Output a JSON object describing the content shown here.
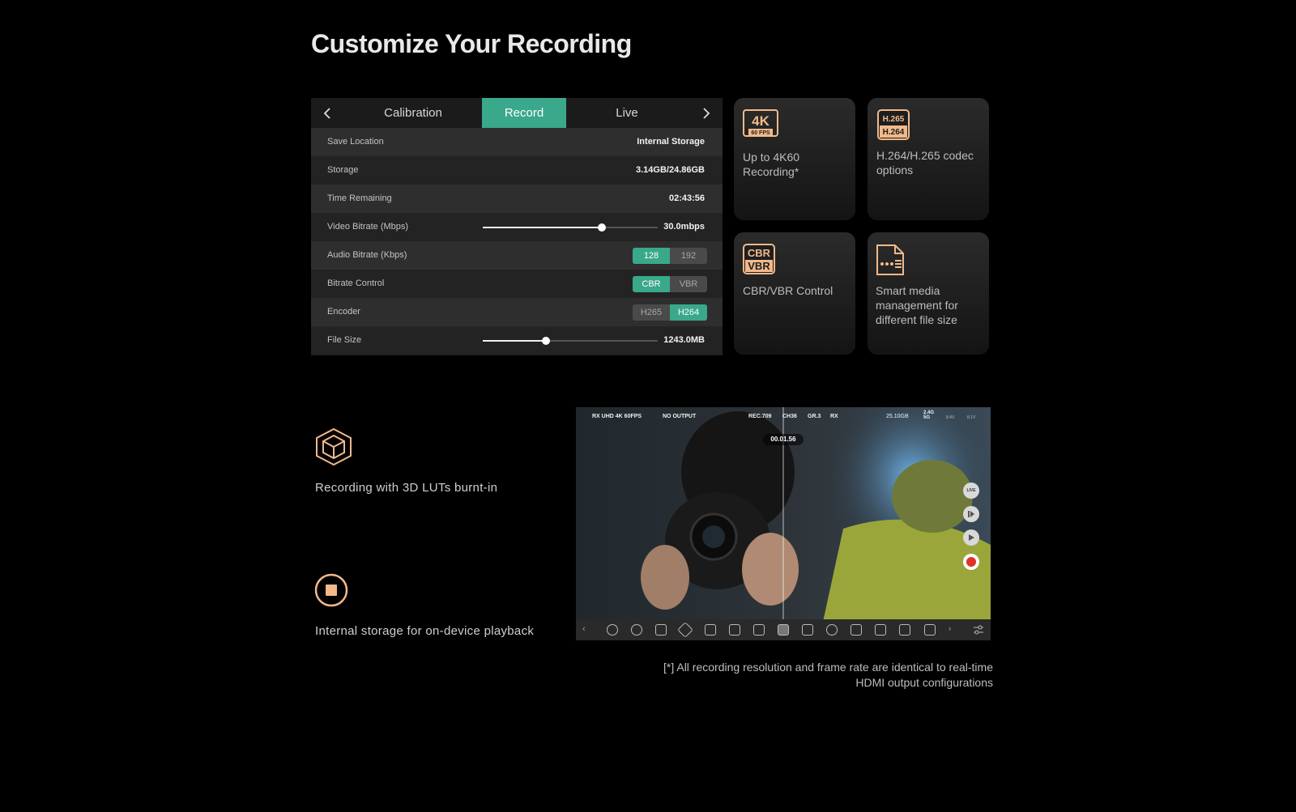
{
  "page": {
    "title": "Customize Your Recording"
  },
  "panel": {
    "tabs": [
      {
        "label": "Calibration",
        "active": false
      },
      {
        "label": "Record",
        "active": true
      },
      {
        "label": "Live",
        "active": false
      }
    ],
    "accent_color": "#3aa88a",
    "rows": [
      {
        "label": "Save Location",
        "value": "Internal Storage"
      },
      {
        "label": "Storage",
        "value": "3.14GB/24.86GB"
      },
      {
        "label": "Time Remaining",
        "value": "02:43:56"
      },
      {
        "label": "Video Bitrate (Mbps)",
        "value": "30.0mbps",
        "slider_fraction": 0.68
      },
      {
        "label": "Audio Bitrate (Kbps)",
        "options": [
          "128",
          "192"
        ],
        "selected": "128"
      },
      {
        "label": "Bitrate Control",
        "options": [
          "CBR",
          "VBR"
        ],
        "selected": "CBR"
      },
      {
        "label": "Encoder",
        "options": [
          "H265",
          "H264"
        ],
        "selected": "H264"
      },
      {
        "label": "File Size",
        "value": "1243.0MB",
        "slider_fraction": 0.36
      }
    ]
  },
  "cards": [
    {
      "icon": "4k-60fps-icon",
      "icon_main": "4K",
      "icon_sub": "60 FPS",
      "text": "Up to 4K60 Recording*"
    },
    {
      "icon": "h265-h264-icon",
      "icon_main": "H.265",
      "icon_sub": "H.264",
      "text": "H.264/H.265 codec options"
    },
    {
      "icon": "cbr-vbr-icon",
      "icon_main": "CBR",
      "icon_sub": "VBR",
      "text": "CBR/VBR Control"
    },
    {
      "icon": "media-file-icon",
      "text": "Smart media management for different file size"
    }
  ],
  "features": [
    {
      "icon": "3d-lut-cube-icon",
      "text": "Recording with 3D LUTs burnt-in"
    },
    {
      "icon": "record-stop-icon",
      "text": "Internal storage for on-device playback"
    }
  ],
  "monitor": {
    "hud_left": [
      "RX UHD 4K 60FPS",
      "NO OUTPUT"
    ],
    "hud_center": [
      "REC.709",
      "CH36",
      "GR.3",
      "RX"
    ],
    "hud_right": [
      "25.10GB",
      "2.4G 5G",
      "8.4V",
      "8.1V"
    ],
    "timer": "00.01.56",
    "side_buttons": [
      "LIVE"
    ]
  },
  "footnote": "[*] All recording resolution and frame rate are identical to real-time HDMI output configurations"
}
